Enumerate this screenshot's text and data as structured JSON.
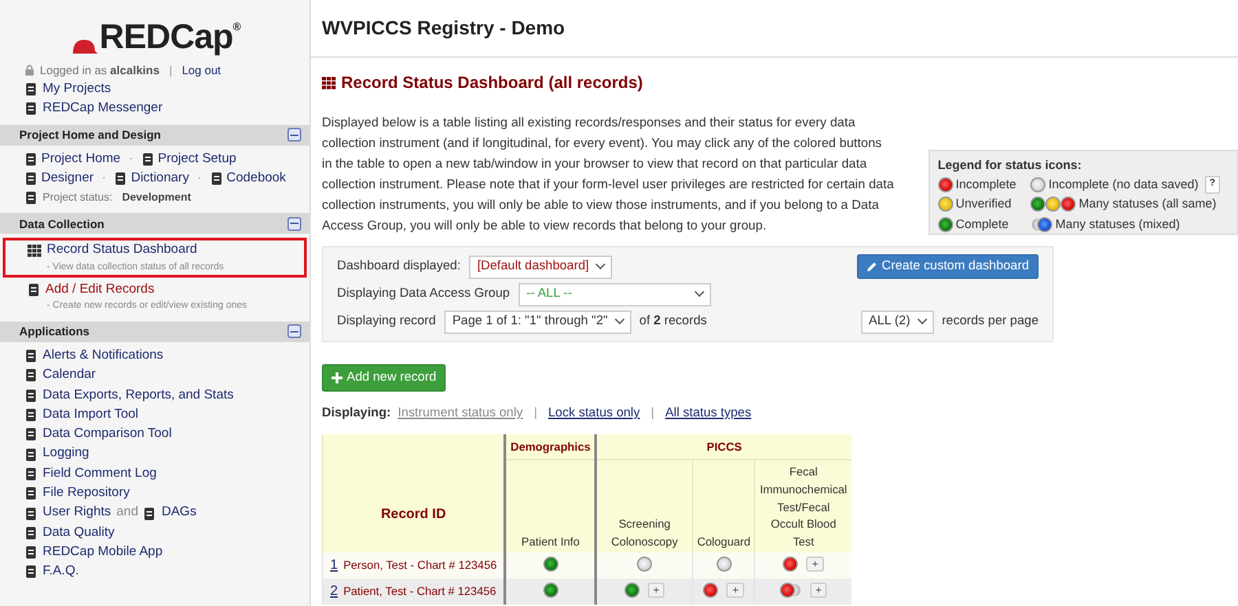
{
  "logo": {
    "text": "REDCap$^{®}$"
  },
  "login": {
    "prefix": "Logged in as",
    "user": "alcalkins",
    "separator": "|",
    "logout": "Log out"
  },
  "top_links": [
    {
      "label": "My Projects"
    },
    {
      "label": "REDCap Messenger"
    }
  ],
  "project_home_design": {
    "title": "Project Home and Design",
    "separator": "·",
    "link_rows": [
      [
        {
          "label": "Project Home"
        },
        {
          "label": "Project Setup"
        }
      ],
      [
        {
          "label": "Designer"
        },
        {
          "label": "Dictionary"
        },
        {
          "label": "Codebook"
        }
      ]
    ],
    "status_label": "Project status:",
    "status_value": "Development"
  },
  "data_collection": {
    "title": "Data Collection",
    "items": [
      {
        "label": "Record Status Dashboard",
        "sublabel": "- View data collection status of all records",
        "highlighted": true
      },
      {
        "label": "Add / Edit Records",
        "sublabel": "- Create new records or edit/view existing ones",
        "highlighted": false
      }
    ]
  },
  "applications": {
    "title": "Applications",
    "items": [
      {
        "label": "Alerts & Notifications"
      },
      {
        "label": "Calendar"
      },
      {
        "label": "Data Exports, Reports, and Stats"
      },
      {
        "label": "Data Import Tool"
      },
      {
        "label": "Data Comparison Tool"
      },
      {
        "label": "Logging"
      },
      {
        "label": "Field Comment Log"
      },
      {
        "label": "File Repository"
      },
      {
        "label": "User Rights",
        "joiner": "and",
        "label2": "DAGs"
      },
      {
        "label": "Data Quality"
      },
      {
        "label": "REDCap Mobile App"
      },
      {
        "label": "F.A.Q."
      }
    ]
  },
  "header": {
    "title": "WVPICCS Registry - Demo"
  },
  "page_title": "Record Status Dashboard (all records)",
  "description": "Displayed below is a table listing all existing records/responses and their status for every data collection instrument (and if longitudinal, for every event). You may click any of the colored buttons in the table to open a new tab/window in your browser to view that record on that particular data collection instrument. Please note that if your form-level user privileges are restricted for certain data collection instruments, you will only be able to view those instruments, and if you belong to a Data Access Group, you will only be able to view records that belong to your group.",
  "legend": {
    "title": "Legend for status icons:",
    "items": [
      {
        "kind": "incomplete",
        "label": "Incomplete"
      },
      {
        "kind": "empty",
        "label": "Incomplete (no data saved)",
        "help": "?"
      },
      {
        "kind": "unverified",
        "label": "Unverified"
      },
      {
        "kind": "many_same",
        "label": "Many statuses (all same)"
      },
      {
        "kind": "complete",
        "label": "Complete"
      },
      {
        "kind": "many_mixed",
        "label": "Many statuses (mixed)"
      }
    ]
  },
  "controls": {
    "dashboard_label": "Dashboard displayed:",
    "dashboard_value": "[Default dashboard]",
    "create_button": "Create custom dashboard",
    "dag_label": "Displaying Data Access Group",
    "dag_value": "-- ALL --",
    "record_label": "Displaying record",
    "record_value": "Page 1 of 1: \"1\" through \"2\"",
    "record_count": "of **2** records",
    "per_page_value": "ALL (2)",
    "per_page_label": "records per page"
  },
  "add_button": "Add new record",
  "display_options": {
    "label": "Displaying:",
    "separator": "|",
    "options": [
      {
        "label": "Instrument status only",
        "selected": true
      },
      {
        "label": "Lock status only",
        "selected": false
      },
      {
        "label": "All status types",
        "selected": false
      }
    ]
  },
  "table": {
    "record_header": "Record ID",
    "groups": [
      {
        "label": "Demographics",
        "instruments": [
          "Patient Info"
        ]
      },
      {
        "label": "PICCS",
        "instruments": [
          "Screening Colonoscopy",
          "Cologuard",
          "Fecal Immunochemical Test/Fecal Occult Blood Test"
        ]
      }
    ],
    "rows": [
      {
        "id": "1",
        "name": "Person, Test - Chart # 123456",
        "cells": [
          {
            "kind": "complete"
          },
          {
            "kind": "empty"
          },
          {
            "kind": "empty"
          },
          {
            "kind": "incomplete",
            "plus": "+"
          }
        ]
      },
      {
        "id": "2",
        "name": "Patient, Test - Chart # 123456",
        "cells": [
          {
            "kind": "complete"
          },
          {
            "kind": "complete",
            "plus": "+"
          },
          {
            "kind": "incomplete",
            "plus": "+"
          },
          {
            "kind": "incomplete_many",
            "plus": "+"
          }
        ]
      }
    ]
  }
}
